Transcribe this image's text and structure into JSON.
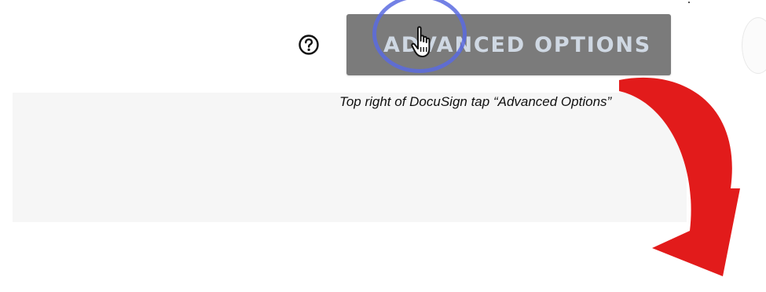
{
  "toolbar": {
    "help_icon": "question-circle-icon",
    "advanced_options_label": "ADVANCED OPTIONS"
  },
  "caption": {
    "text": "Top right of DocuSign tap “Advanced Options”"
  },
  "annotation": {
    "arrow_color": "#e21b1b",
    "ring_color": "#5a6be0",
    "cursor_icon": "hand-pointer-icon",
    "arrow_icon": "curved-arrow-down-icon"
  },
  "colors": {
    "button_bg": "#7b7b7b",
    "button_text": "#cfd8e3",
    "panel_bg": "#f6f6f6"
  }
}
